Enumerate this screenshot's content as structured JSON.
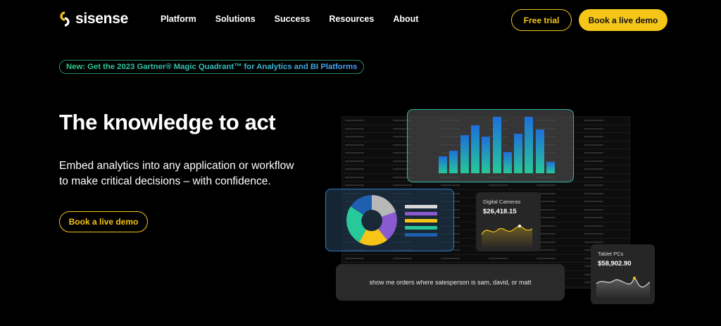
{
  "header": {
    "logo_text": "sisense",
    "nav": [
      {
        "label": "Platform"
      },
      {
        "label": "Solutions"
      },
      {
        "label": "Success"
      },
      {
        "label": "Resources"
      },
      {
        "label": "About"
      }
    ],
    "trial_label": "Free trial",
    "demo_label": "Book a live demo"
  },
  "banner": {
    "text": "New: Get the 2023 Gartner® Magic Quadrant™ for Analytics and BI Platforms"
  },
  "hero": {
    "title": "The knowledge to act",
    "subtitle": "Embed analytics into any application or workflow to make critical decisions – with confidence.",
    "cta_label": "Book a live demo"
  },
  "illustration": {
    "card_cameras": {
      "label": "Digital Cameras",
      "value": "$26,418.15"
    },
    "card_tablets": {
      "label": "Tablet PCs",
      "value": "$58,902.90"
    },
    "query_text": "show me orders where salesperson is sam, david, or matt"
  },
  "colors": {
    "accent": "#f5c518",
    "background": "#000000",
    "teal": "#27c89a",
    "blue": "#1e6fd9"
  }
}
